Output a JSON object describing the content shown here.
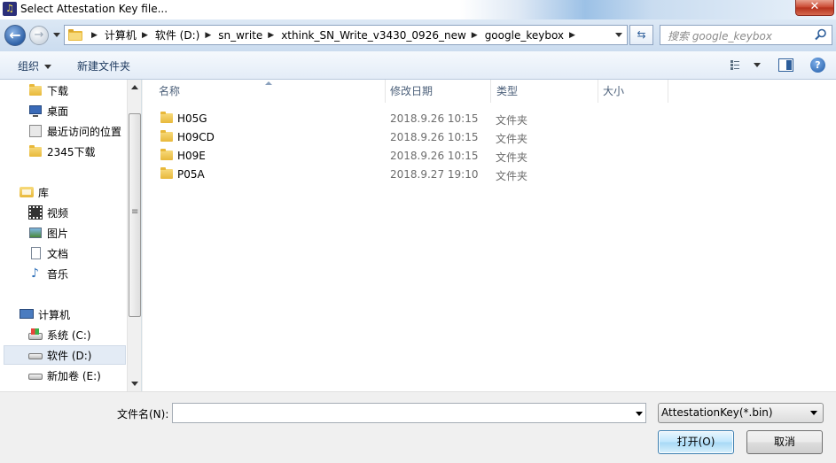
{
  "window": {
    "title": "Select Attestation Key file...",
    "close_label": "✕"
  },
  "address": {
    "crumbs": [
      "计算机",
      "软件 (D:)",
      "sn_write",
      "xthink_SN_Write_v3430_0926_new",
      "google_keybox"
    ],
    "search_placeholder": "搜索 google_keybox"
  },
  "toolbar": {
    "organize_label": "组织",
    "new_folder_label": "新建文件夹",
    "help_label": "?"
  },
  "nav": {
    "items": [
      {
        "label": "下载",
        "icon": "download-folder-icon"
      },
      {
        "label": "桌面",
        "icon": "desktop-icon"
      },
      {
        "label": "最近访问的位置",
        "icon": "recent-places-icon"
      },
      {
        "label": "2345下载",
        "icon": "folder-icon"
      },
      {
        "label": "库",
        "icon": "library-icon"
      },
      {
        "label": "视频",
        "icon": "video-library-icon"
      },
      {
        "label": "图片",
        "icon": "pictures-library-icon"
      },
      {
        "label": "文档",
        "icon": "documents-library-icon"
      },
      {
        "label": "音乐",
        "icon": "music-library-icon"
      },
      {
        "label": "计算机",
        "icon": "computer-icon"
      },
      {
        "label": "系统 (C:)",
        "icon": "system-drive-icon"
      },
      {
        "label": "软件 (D:)",
        "icon": "drive-icon",
        "selected": true
      },
      {
        "label": "新加卷 (E:)",
        "icon": "drive-icon"
      }
    ]
  },
  "filelist": {
    "columns": [
      "名称",
      "修改日期",
      "类型",
      "大小"
    ],
    "rows": [
      {
        "name": "H05G",
        "date": "2018.9.26 10:15",
        "type": "文件夹"
      },
      {
        "name": "H09CD",
        "date": "2018.9.26 10:15",
        "type": "文件夹"
      },
      {
        "name": "H09E",
        "date": "2018.9.26 10:15",
        "type": "文件夹"
      },
      {
        "name": "P05A",
        "date": "2018.9.27 19:10",
        "type": "文件夹"
      }
    ]
  },
  "bottom": {
    "filename_label": "文件名(N):",
    "filename_value": "",
    "filter_value": "AttestationKey(*.bin)",
    "open_label": "打开(O)",
    "cancel_label": "取消"
  },
  "colors": {
    "selected_nav_bg": "#e3ebf5",
    "open_button_border": "#3c7fb1",
    "folder": "#e8b83a"
  }
}
